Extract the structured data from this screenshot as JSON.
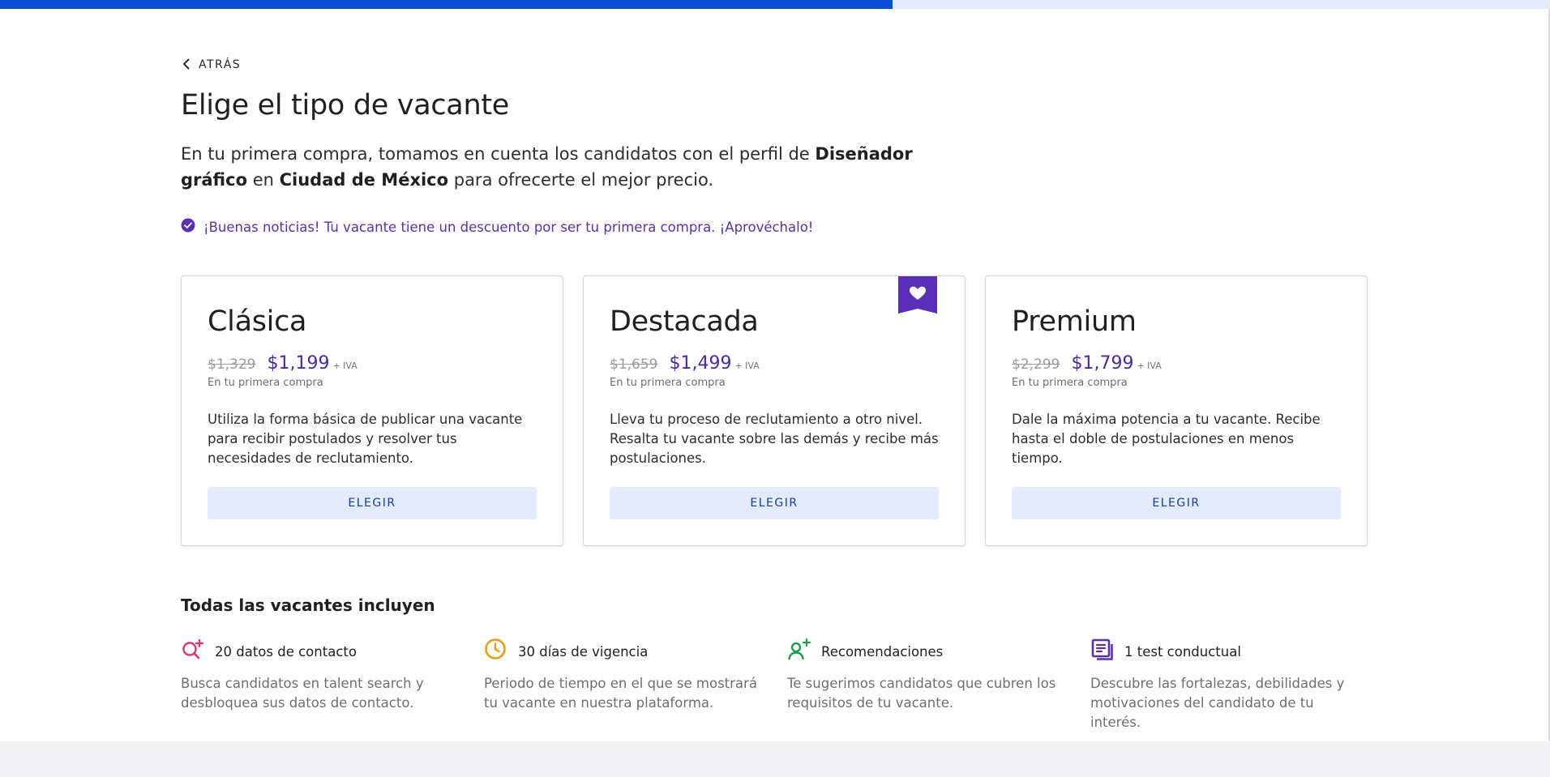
{
  "progress": {
    "fraction": 0.576,
    "fill_color": "#0a4ed6",
    "track_color": "#e3ebfb"
  },
  "nav": {
    "back_label": "ATRÁS",
    "back_icon": "chevron-left-icon"
  },
  "title": "Elige el tipo de vacante",
  "intro": {
    "part1": "En tu primera compra, tomamos en cuenta los candidatos con el perfil de ",
    "profile": "Diseñador gráfico",
    "part2": " en ",
    "city": "Ciudad de México",
    "part3": " para ofrecerte el mejor precio."
  },
  "notice": {
    "icon": "check-circle-icon",
    "text": "¡Buenas noticias! Tu vacante tiene un descuento por ser tu primera compra. ¡Aprovéchalo!",
    "color": "#5a2fb8"
  },
  "plans": [
    {
      "name": "Clásica",
      "old_price": "$1,329",
      "price": "$1,199",
      "tax": "+ IVA",
      "note": "En tu primera compra",
      "description": "Utiliza la forma básica de publicar una vacante para recibir postulados y resolver tus necesidades de reclutamiento.",
      "button": "ELEGIR",
      "featured": false
    },
    {
      "name": "Destacada",
      "old_price": "$1,659",
      "price": "$1,499",
      "tax": "+ IVA",
      "note": "En tu primera compra",
      "description": "Lleva tu proceso de reclutamiento a otro nivel. Resalta tu vacante sobre las demás y recibe más postulaciones.",
      "button": "ELEGIR",
      "featured": true,
      "badge_icon": "heart-bookmark-icon"
    },
    {
      "name": "Premium",
      "old_price": "$2,299",
      "price": "$1,799",
      "tax": "+ IVA",
      "note": "En tu primera compra",
      "description": "Dale la máxima potencia a tu vacante. Recibe hasta el doble de postulaciones en menos tiempo.",
      "button": "ELEGIR",
      "featured": false
    }
  ],
  "includes": {
    "title": "Todas las vacantes incluyen",
    "items": [
      {
        "icon": "search-plus-icon",
        "color": "#e0306f",
        "title": "20 datos de contacto",
        "description": "Busca candidatos en talent search y desbloquea sus datos de contacto."
      },
      {
        "icon": "clock-icon",
        "color": "#f09a0a",
        "title": "30 días de vigencia",
        "description": "Periodo de tiempo en el que se mostrará tu vacante en nuestra plataforma."
      },
      {
        "icon": "user-plus-icon",
        "color": "#1a9e4f",
        "title": "Recomendaciones",
        "description": "Te sugerimos candidatos que cubren los requisitos de tu vacante."
      },
      {
        "icon": "document-icon",
        "color": "#5a2fb8",
        "title": "1 test conductual",
        "description": "Descubre las fortalezas, debilidades y motivaciones del candidato de tu interés."
      }
    ]
  },
  "colors": {
    "accent_purple": "#4a27a8",
    "button_bg": "#e3ebfd",
    "button_text": "#0f3fa6"
  }
}
